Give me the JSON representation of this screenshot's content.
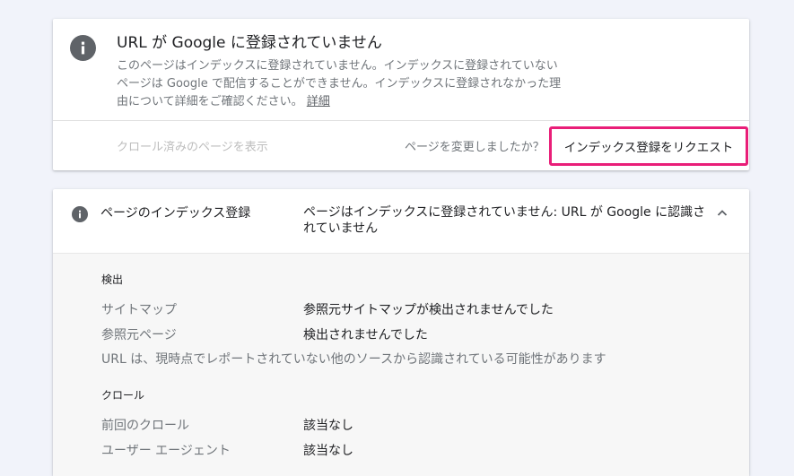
{
  "status_card": {
    "title": "URL が Google に登録されていません",
    "description": "このページはインデックスに登録されていません。インデックスに登録されていないページは Google で配信することができません。インデックスに登録されなかった理由について詳細をご確認ください。",
    "details_link": "詳細",
    "crawled_page_link": "クロール済みのページを表示",
    "changed_question": "ページを変更しましたか？",
    "request_button": "インデックス登録をリクエスト",
    "highlight_color": "#e91e78"
  },
  "index_card": {
    "label": "ページのインデックス登録",
    "value": "ページはインデックスに登録されていません: URL が Google に認識されていません",
    "sections": {
      "discovery": {
        "heading": "検出",
        "rows": [
          {
            "label": "サイトマップ",
            "value": "参照元サイトマップが検出されませんでした"
          },
          {
            "label": "参照元ページ",
            "value": "検出されませんでした"
          }
        ],
        "note": "URL は、現時点でレポートされていない他のソースから認識されている可能性があります"
      },
      "crawl": {
        "heading": "クロール",
        "rows": [
          {
            "label": "前回のクロール",
            "value": "該当なし"
          },
          {
            "label": "ユーザー エージェント",
            "value": "該当なし"
          }
        ]
      }
    }
  },
  "icons": {
    "status": "info-icon",
    "index": "info-icon",
    "collapse": "chevron-up-icon"
  }
}
